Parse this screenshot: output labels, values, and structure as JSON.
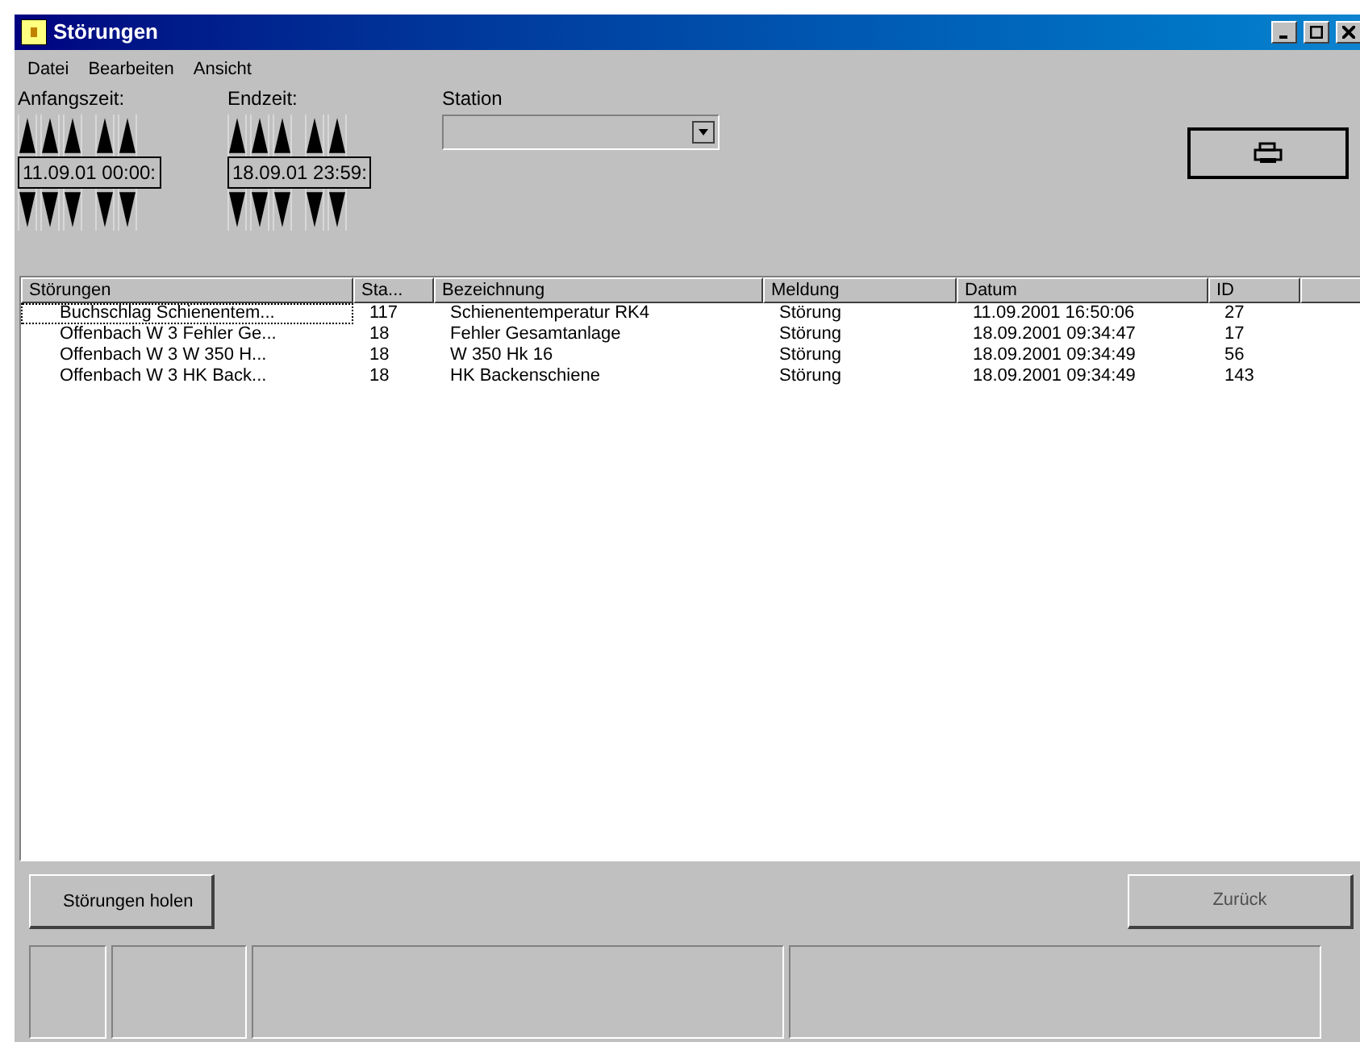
{
  "window": {
    "title": "Störungen"
  },
  "menu": [
    "Datei",
    "Bearbeiten",
    "Ansicht"
  ],
  "filters": [
    {
      "label": "Anfangszeit:",
      "value": "11.09.01 00:00:"
    },
    {
      "label": "Endzeit:",
      "value": "18.09.01 23:59:"
    }
  ],
  "station": {
    "label": "Station"
  },
  "table": {
    "columns": [
      "Störungen",
      "Sta...",
      "Bezeichnung",
      "Meldung",
      "Datum",
      "ID"
    ],
    "rows": [
      {
        "selected": true,
        "cells": [
          "Buchschlag Schienentem...",
          "117",
          "Schienentemperatur RK4",
          "Störung",
          "11.09.2001 16:50:06",
          "27"
        ]
      },
      {
        "selected": false,
        "cells": [
          "Offenbach W 3 Fehler Ge...",
          "18",
          "Fehler Gesamtanlage",
          "Störung",
          "18.09.2001 09:34:47",
          "17"
        ]
      },
      {
        "selected": false,
        "cells": [
          "Offenbach W 3 W 350 H...",
          "18",
          "W 350 Hk 16",
          "Störung",
          "18.09.2001 09:34:49",
          "56"
        ]
      },
      {
        "selected": false,
        "cells": [
          "Offenbach W 3 HK Back...",
          "18",
          "HK Backenschiene",
          "Störung",
          "18.09.2001 09:34:49",
          "143"
        ]
      }
    ]
  },
  "buttons": [
    {
      "label": "Störungen holen",
      "disabled": false
    },
    {
      "label": "Zurück",
      "disabled": true
    }
  ]
}
